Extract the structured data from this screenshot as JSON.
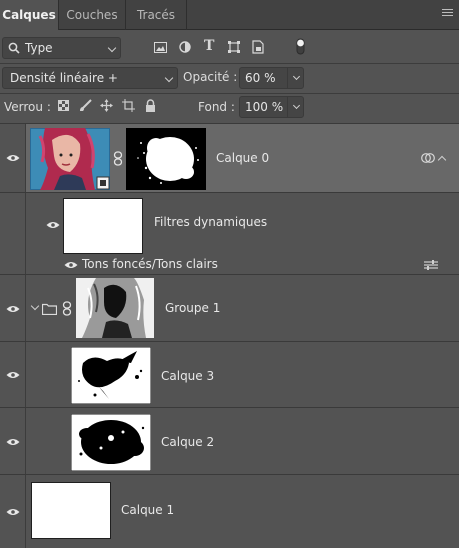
{
  "tabs": [
    {
      "label": "Calques",
      "active": true
    },
    {
      "label": "Couches",
      "active": false
    },
    {
      "label": "Tracés",
      "active": false
    }
  ],
  "filter": {
    "kind_label": "Type",
    "icons": [
      "image-filter-icon",
      "adjustment-filter-icon",
      "text-filter-icon",
      "shape-filter-icon",
      "smartobject-filter-icon",
      "filter-toggle-icon"
    ]
  },
  "blend": {
    "mode": "Densité linéaire +",
    "opacity_label": "Opacité :",
    "opacity_value": "60 %"
  },
  "lock": {
    "label": "Verrou :",
    "icons": [
      "lock-transparency-icon",
      "lock-pixels-icon",
      "lock-position-icon",
      "lock-artboard-icon",
      "lock-all-icon"
    ],
    "fill_label": "Fond :",
    "fill_value": "100 %"
  },
  "layers": [
    {
      "name": "Calque 0",
      "selected": true
    },
    {
      "name": "Filtres dynamiques"
    },
    {
      "name": "Tons foncés/Tons clairs"
    },
    {
      "name": "Groupe 1"
    },
    {
      "name": "Calque 3"
    },
    {
      "name": "Calque 2"
    },
    {
      "name": "Calque 1"
    }
  ],
  "colors": {
    "panel_bg": "#535353",
    "tab_bg": "#424242",
    "selected_row": "#686868",
    "text": "#e4e4e4"
  }
}
